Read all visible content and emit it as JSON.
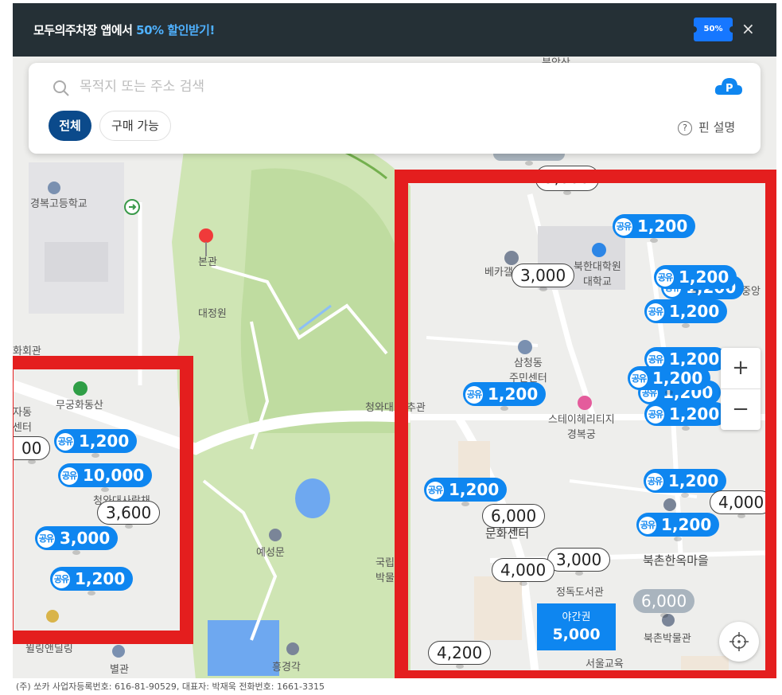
{
  "banner": {
    "promo_prefix": "모두의주차장 앱에서 ",
    "promo_highlight": "50% 할인받기!",
    "coupon_label": "50%",
    "close_label": "×"
  },
  "search": {
    "placeholder": "목적지 또는 주소 검색",
    "search_icon": "search-icon",
    "logo_icon": "parking-cloud-logo-icon"
  },
  "filters": {
    "all_label": "전체",
    "purchasable_label": "구매 가능",
    "pin_help_label": "핀 설명"
  },
  "map_labels": {
    "top_hill": "북악산",
    "school_gyeongbok": "경복고등학교",
    "bonkwan": "본관",
    "daejeongwon": "대정원",
    "partial_hall": "화회관",
    "mugung": "무궁화동산",
    "self_center": "자동\n센터",
    "cheongwadae_sarangchae": "청와대사랑채",
    "cheongwadae_chun": "청와대 춘추관",
    "bekaga": "베카갤",
    "bukhan_univ": "북한대학원\n대학교",
    "junganggo": "중앙",
    "samcheong_center": "삼청동\n주민센터",
    "stayheritage": "스테이헤리티지\n경복궁",
    "gukrip": "국립\n박물",
    "yesungmun": "예성문",
    "culture_center": "문화센터",
    "jeongdok_library": "정독도서관",
    "bukchon_village": "북촌한옥마을",
    "bukchon_museum": "북촌박물관",
    "seoul_edu": "서울교육",
    "heunggyeong": "흥경각",
    "byeolgwan": "별관",
    "willing": "윌링앤딜링"
  },
  "price_pins": [
    {
      "kind": "grey",
      "price": "",
      "note": "partially hidden pin top"
    },
    {
      "kind": "white",
      "price": "3,000"
    },
    {
      "kind": "blue",
      "price": "1,200",
      "shared_label": "공유"
    },
    {
      "kind": "blue",
      "price": "1,200",
      "shared_label": "공유"
    },
    {
      "kind": "blue",
      "price": "1,200",
      "shared_label": "공유"
    },
    {
      "kind": "blue",
      "price": "1,200",
      "shared_label": "공유"
    },
    {
      "kind": "blue",
      "price": "1,200",
      "shared_label": "공유"
    },
    {
      "kind": "blue",
      "price": "1,200",
      "shared_label": "공유"
    },
    {
      "kind": "blue",
      "price": "1,200",
      "shared_label": "공유"
    },
    {
      "kind": "blue",
      "price": "1,200",
      "shared_label": "공유"
    },
    {
      "kind": "blue",
      "price": "1,200",
      "shared_label": "공유"
    },
    {
      "kind": "blue",
      "price": "1,200",
      "shared_label": "공유"
    },
    {
      "kind": "white",
      "price": "6,000"
    },
    {
      "kind": "blue",
      "price": "1,200",
      "shared_label": "공유"
    },
    {
      "kind": "white",
      "price": "4,000"
    },
    {
      "kind": "white",
      "price": "3,000"
    },
    {
      "kind": "white",
      "price": "4,000"
    },
    {
      "kind": "grey",
      "price": "6,000"
    },
    {
      "kind": "white",
      "price": "4,200"
    },
    {
      "kind": "white",
      "price": "00"
    },
    {
      "kind": "blue",
      "price": "1,200",
      "shared_label": "공유"
    },
    {
      "kind": "blue",
      "price": "10,000",
      "shared_label": "공유"
    },
    {
      "kind": "white",
      "price": "3,600"
    },
    {
      "kind": "blue",
      "price": "3,000",
      "shared_label": "공유"
    },
    {
      "kind": "blue",
      "price": "1,200",
      "shared_label": "공유"
    }
  ],
  "night_pin": {
    "title": "야간권",
    "price": "5,000"
  },
  "zoom": {
    "in_label": "+",
    "out_label": "−"
  },
  "footer": {
    "text": "(주) 쏘카    사업자등록번호: 616-81-90529, 대표자: 박재욱    전화번호: 1661-3315"
  },
  "colors": {
    "brand_blue": "#0e86f0",
    "highlight_red": "#e41e1e",
    "banner_bg": "#253036",
    "chip_active": "#0b4a8b"
  }
}
